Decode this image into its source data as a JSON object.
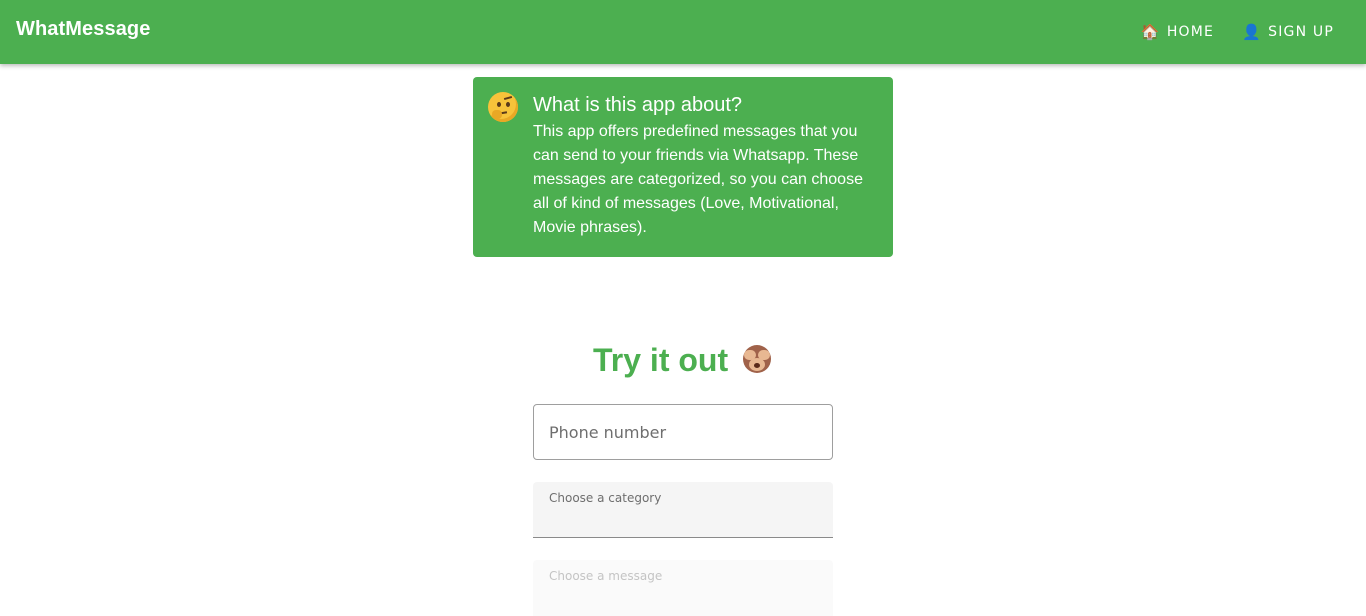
{
  "header": {
    "brand": "WhatMessage",
    "nav": [
      {
        "icon": "house-icon",
        "glyph": "🏠",
        "label": "HOME"
      },
      {
        "icon": "user-icon",
        "glyph": "👤",
        "label": "SIGN UP"
      }
    ]
  },
  "info": {
    "title": "What is this app about?",
    "text": "This app offers predefined messages that you can send to your friends via Whatsapp. These messages are categorized, so you can choose all of kind of messages (Love, Motivational, Movie phrases)."
  },
  "try": {
    "title": "Try it out"
  },
  "form": {
    "phone_placeholder": "Phone number",
    "category_label": "Choose a category",
    "message_label": "Choose a message"
  },
  "colors": {
    "brand_green": "#4caf50"
  }
}
